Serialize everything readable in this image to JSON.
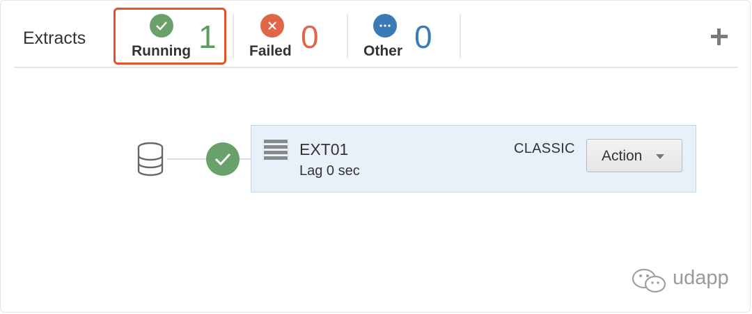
{
  "header": {
    "title": "Extracts",
    "tabs": [
      {
        "label": "Running",
        "count": "1",
        "color": "#5e9c5e",
        "icon": "check-icon"
      },
      {
        "label": "Failed",
        "count": "0",
        "color": "#e0664a",
        "icon": "close-icon"
      },
      {
        "label": "Other",
        "count": "0",
        "color": "#3a7bb5",
        "icon": "more-icon"
      }
    ],
    "add_icon": "plus-icon"
  },
  "process": {
    "name": "EXT01",
    "lag": "Lag 0 sec",
    "type": "CLASSIC",
    "status": "running",
    "status_color": "#6aa06a",
    "source_icon": "database-icon",
    "action_label": "Action"
  },
  "watermark": {
    "text": "udapp"
  },
  "colors": {
    "highlight": "#e8512a",
    "card_background": "#e8f1f9"
  }
}
